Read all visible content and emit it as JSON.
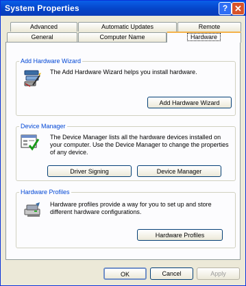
{
  "window": {
    "title": "System Properties",
    "help_label": "?",
    "close_label": "✕"
  },
  "tabs_row1": [
    {
      "label": "Advanced"
    },
    {
      "label": "Automatic Updates"
    },
    {
      "label": "Remote"
    }
  ],
  "tabs_row2": [
    {
      "label": "General"
    },
    {
      "label": "Computer Name"
    },
    {
      "label": "Hardware",
      "active": true
    }
  ],
  "add_hardware": {
    "title": "Add Hardware Wizard",
    "description": "The Add Hardware Wizard helps you install hardware.",
    "button": "Add Hardware Wizard"
  },
  "device_manager": {
    "title": "Device Manager",
    "description": "The Device Manager lists all the hardware devices installed on your computer. Use the Device Manager to change the properties of any device.",
    "driver_signing_button": "Driver Signing",
    "device_manager_button": "Device Manager"
  },
  "hardware_profiles": {
    "title": "Hardware Profiles",
    "description": "Hardware profiles provide a way for you to set up and store different hardware configurations.",
    "button": "Hardware Profiles"
  },
  "footer": {
    "ok": "OK",
    "cancel": "Cancel",
    "apply": "Apply"
  },
  "icons": [
    "wizard-icon",
    "device-manager-icon",
    "hardware-profiles-icon",
    "help-icon",
    "close-icon"
  ]
}
